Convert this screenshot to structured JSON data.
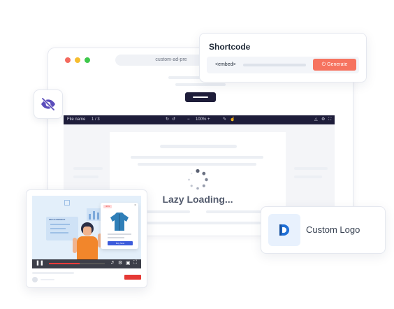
{
  "browser": {
    "url": "custom-ad-pre",
    "dot_colors": [
      "#f46a5e",
      "#f6bd2f",
      "#3ec84b"
    ]
  },
  "viewer": {
    "file_name": "File name",
    "page_indicator": "1  /  3",
    "zoom": "100%",
    "loading_text": "Lazy Loading..."
  },
  "shortcode": {
    "title": "Shortcode",
    "embed": "<embed>",
    "generate_label": "Generate"
  },
  "video": {
    "sale_badge": "40%",
    "popup_button": "Buy Now",
    "scene_label": "MEASUREMENT",
    "progress": 0.55,
    "accent": "#ff3b3b"
  },
  "logo": {
    "label": "Custom Logo",
    "accent": "#1f6fd6"
  },
  "icons": {
    "hidden": "eye-slash-icon",
    "generate": "power-icon",
    "logo": "d-logo-icon"
  }
}
